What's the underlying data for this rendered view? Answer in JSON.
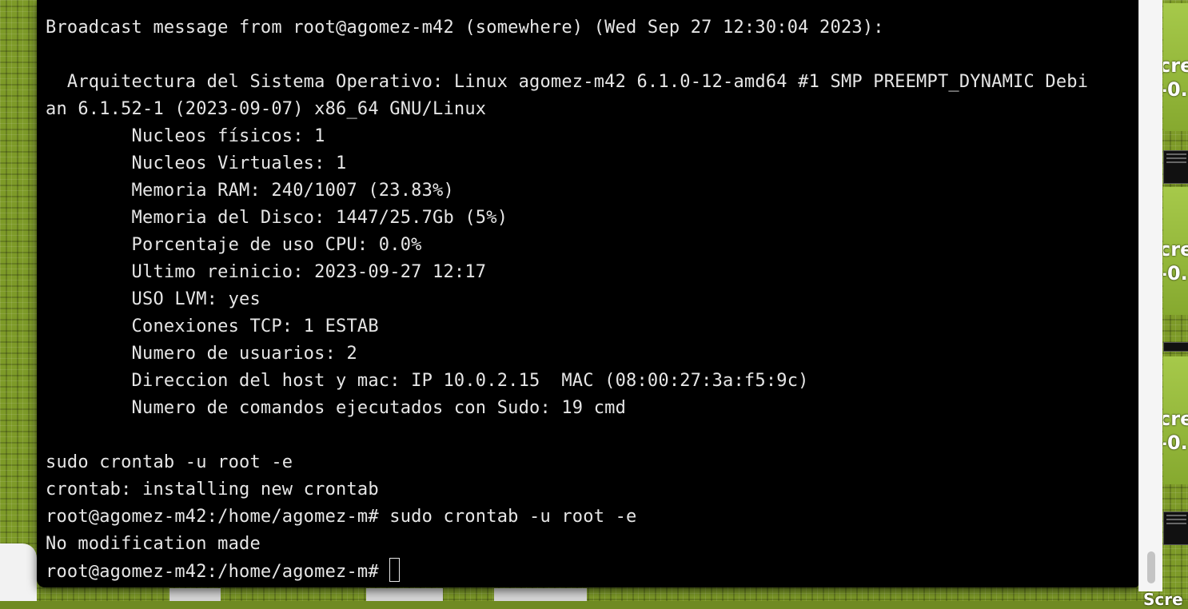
{
  "terminal": {
    "lines": [
      "Broadcast message from root@agomez-m42 (somewhere) (Wed Sep 27 12:30:04 2023):",
      "",
      "  Arquitectura del Sistema Operativo: Linux agomez-m42 6.1.0-12-amd64 #1 SMP PREEMPT_DYNAMIC Debi",
      "an 6.1.52-1 (2023-09-07) x86_64 GNU/Linux",
      "        Nucleos físicos: 1",
      "        Nucleos Virtuales: 1",
      "        Memoria RAM: 240/1007 (23.83%)",
      "        Memoria del Disco: 1447/25.7Gb (5%)",
      "        Porcentaje de uso CPU: 0.0%",
      "        Ultimo reinicio: 2023-09-27 12:17",
      "        USO LVM: yes",
      "        Conexiones TCP: 1 ESTAB",
      "        Numero de usuarios: 2",
      "        Direccion del host y mac: IP 10.0.2.15  MAC (08:00:27:3a:f5:9c)",
      "        Numero de comandos ejecutados con Sudo: 19 cmd",
      "",
      "sudo crontab -u root -e",
      "crontab: installing new crontab",
      "root@agomez-m42:/home/agomez-m# sudo crontab -u root -e",
      "No modification made"
    ],
    "prompt": "root@agomez-m42:/home/agomez-m# "
  },
  "thumbnails": [
    {
      "line1": "cre",
      "line2": "-0."
    },
    {
      "line1": "cre",
      "line2": "-0."
    },
    {
      "line1": "cre",
      "line2": "-0."
    }
  ],
  "bottom_label": "Scre"
}
